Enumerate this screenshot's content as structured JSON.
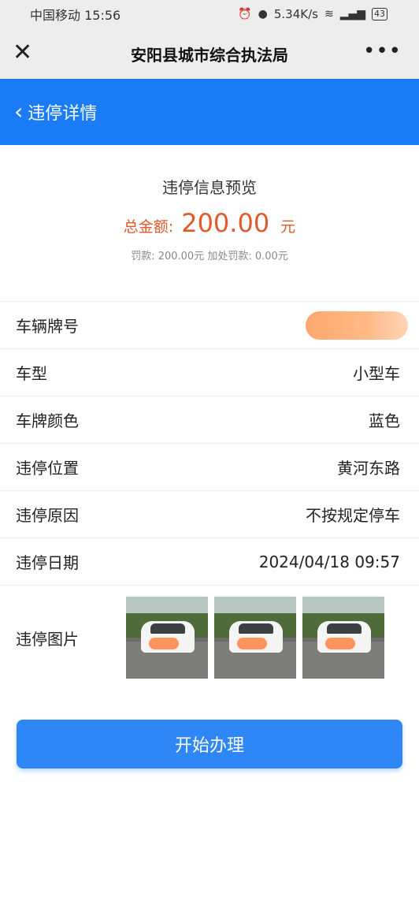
{
  "status_bar": {
    "carrier_time": "中国移动 15:56",
    "network_speed": "5.34K/s",
    "battery": "43"
  },
  "navbar": {
    "title": "安阳县城市综合执法局",
    "close_icon": "close-icon",
    "more_icon": "more-icon"
  },
  "header": {
    "title": "违停详情",
    "back_icon": "chevron-left-icon"
  },
  "summary": {
    "heading": "违停信息预览",
    "total_label": "总金额:",
    "total_value": "200.00",
    "total_unit": "元",
    "detail": "罚款: 200.00元  加处罚款: 0.00元"
  },
  "info_rows": [
    {
      "label": "车辆牌号",
      "value": ""
    },
    {
      "label": "车型",
      "value": "小型车"
    },
    {
      "label": "车牌颜色",
      "value": "蓝色"
    },
    {
      "label": "违停位置",
      "value": "黄河东路"
    },
    {
      "label": "违停原因",
      "value": "不按规定停车"
    },
    {
      "label": "违停日期",
      "value": "2024/04/18 09:57"
    }
  ],
  "photos": {
    "label": "违停图片",
    "count": 3
  },
  "action": {
    "start_label": "开始办理"
  },
  "colors": {
    "primary": "#1a7cf6",
    "button": "#2f86f7",
    "amount": "#e05a2a"
  }
}
